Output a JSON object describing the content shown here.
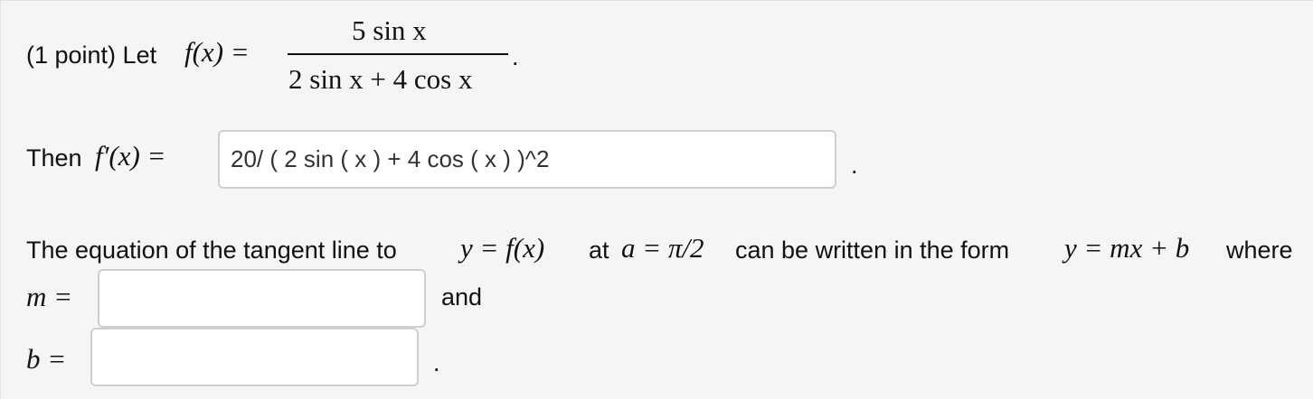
{
  "problem": {
    "prefix": "(1 point) Let",
    "func_lhs": "f(x) =",
    "numerator": "5 sin x",
    "denominator": "2 sin x + 4 cos x",
    "end_period": "."
  },
  "derivative": {
    "prefix": "Then",
    "lhs": "f′(x) =",
    "answer_value": "20/ ( 2 sin ( x ) + 4 cos ( x ) )^2",
    "end_period": "."
  },
  "tangent": {
    "t1": "The equation of the tangent line to",
    "m1": "y = f(x)",
    "t2": "at",
    "m2": "a = π/2",
    "t3": "can be written in the form",
    "m3": "y = mx + b",
    "t4": "where",
    "m_label": "m =",
    "and_text": "and",
    "b_label": "b =",
    "end_period": ".",
    "m_value": "",
    "b_value": ""
  }
}
